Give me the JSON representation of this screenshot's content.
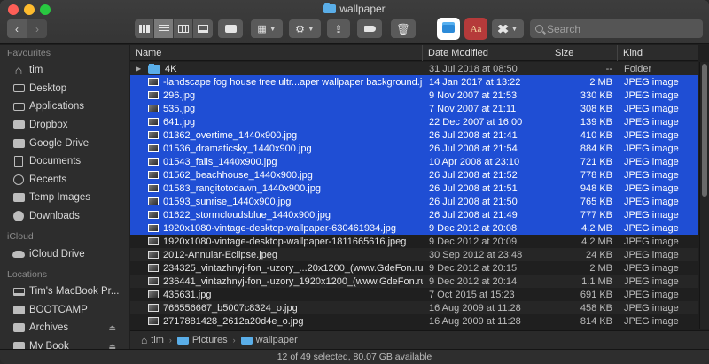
{
  "window": {
    "title": "wallpaper"
  },
  "toolbar": {
    "back_icon": "chevron-left-icon",
    "forward_icon": "chevron-right-icon",
    "search": {
      "placeholder": "Search",
      "value": ""
    },
    "app_dict_label": "Aa"
  },
  "sidebar": {
    "sections": [
      {
        "title": "Favourites",
        "items": [
          {
            "label": "tim",
            "icon": "home-icon"
          },
          {
            "label": "Desktop",
            "icon": "desktop-icon"
          },
          {
            "label": "Applications",
            "icon": "applications-icon"
          },
          {
            "label": "Dropbox",
            "icon": "dropbox-icon"
          },
          {
            "label": "Google Drive",
            "icon": "google-drive-icon"
          },
          {
            "label": "Documents",
            "icon": "documents-icon"
          },
          {
            "label": "Recents",
            "icon": "recents-icon"
          },
          {
            "label": "Temp Images",
            "icon": "folder-icon"
          },
          {
            "label": "Downloads",
            "icon": "downloads-icon"
          }
        ]
      },
      {
        "title": "iCloud",
        "items": [
          {
            "label": "iCloud Drive",
            "icon": "icloud-icon"
          }
        ]
      },
      {
        "title": "Locations",
        "items": [
          {
            "label": "Tim's MacBook Pr...",
            "icon": "laptop-icon"
          },
          {
            "label": "BOOTCAMP",
            "icon": "drive-icon"
          },
          {
            "label": "Archives",
            "icon": "drive-icon",
            "eject": "⏏"
          },
          {
            "label": "My Book",
            "icon": "drive-icon",
            "eject": "⏏"
          }
        ]
      }
    ]
  },
  "table": {
    "columns": {
      "name": "Name",
      "date": "Date Modified",
      "size": "Size",
      "kind": "Kind"
    },
    "rows": [
      {
        "name": "4K",
        "date": "31 Jul 2018 at 08:50",
        "size": "--",
        "kind": "Folder",
        "folder": true,
        "selected": false
      },
      {
        "name": "-landscape fog house tree ultr...aper wallpaper background.jpg",
        "date": "14 Jan 2017 at 13:22",
        "size": "2 MB",
        "kind": "JPEG image",
        "selected": true
      },
      {
        "name": "296.jpg",
        "date": "9 Nov 2007 at 21:53",
        "size": "330 KB",
        "kind": "JPEG image",
        "selected": true
      },
      {
        "name": "535.jpg",
        "date": "7 Nov 2007 at 21:11",
        "size": "308 KB",
        "kind": "JPEG image",
        "selected": true
      },
      {
        "name": "641.jpg",
        "date": "22 Dec 2007 at 16:00",
        "size": "139 KB",
        "kind": "JPEG image",
        "selected": true
      },
      {
        "name": "01362_overtime_1440x900.jpg",
        "date": "26 Jul 2008 at 21:41",
        "size": "410 KB",
        "kind": "JPEG image",
        "selected": true
      },
      {
        "name": "01536_dramaticsky_1440x900.jpg",
        "date": "26 Jul 2008 at 21:54",
        "size": "884 KB",
        "kind": "JPEG image",
        "selected": true
      },
      {
        "name": "01543_falls_1440x900.jpg",
        "date": "10 Apr 2008 at 23:10",
        "size": "721 KB",
        "kind": "JPEG image",
        "selected": true
      },
      {
        "name": "01562_beachhouse_1440x900.jpg",
        "date": "26 Jul 2008 at 21:52",
        "size": "778 KB",
        "kind": "JPEG image",
        "selected": true
      },
      {
        "name": "01583_rangitotodawn_1440x900.jpg",
        "date": "26 Jul 2008 at 21:51",
        "size": "948 KB",
        "kind": "JPEG image",
        "selected": true
      },
      {
        "name": "01593_sunrise_1440x900.jpg",
        "date": "26 Jul 2008 at 21:50",
        "size": "765 KB",
        "kind": "JPEG image",
        "selected": true
      },
      {
        "name": "01622_stormcloudsblue_1440x900.jpg",
        "date": "26 Jul 2008 at 21:49",
        "size": "777 KB",
        "kind": "JPEG image",
        "selected": true
      },
      {
        "name": "1920x1080-vintage-desktop-wallpaper-630461934.jpg",
        "date": "9 Dec 2012 at 20:08",
        "size": "4.2 MB",
        "kind": "JPEG image",
        "selected": true
      },
      {
        "name": "1920x1080-vintage-desktop-wallpaper-1811665616.jpeg",
        "date": "9 Dec 2012 at 20:09",
        "size": "4.2 MB",
        "kind": "JPEG image",
        "selected": false
      },
      {
        "name": "2012-Annular-Eclipse.jpeg",
        "date": "30 Sep 2012 at 23:48",
        "size": "24 KB",
        "kind": "JPEG image",
        "selected": false
      },
      {
        "name": "234325_vintazhnyj-fon_-uzory_...20x1200_(www.GdeFon.ru).jpg",
        "date": "9 Dec 2012 at 20:15",
        "size": "2 MB",
        "kind": "JPEG image",
        "selected": false
      },
      {
        "name": "236441_vintazhnyj-fon_-uzory_1920x1200_(www.GdeFon.ru).jpg",
        "date": "9 Dec 2012 at 20:14",
        "size": "1.1 MB",
        "kind": "JPEG image",
        "selected": false
      },
      {
        "name": "435631.jpg",
        "date": "7 Oct 2015 at 15:23",
        "size": "691 KB",
        "kind": "JPEG image",
        "selected": false
      },
      {
        "name": "766556667_b5007c8324_o.jpg",
        "date": "16 Aug 2009 at 11:28",
        "size": "458 KB",
        "kind": "JPEG image",
        "selected": false
      },
      {
        "name": "2717881428_2612a20d4e_o.jpg",
        "date": "16 Aug 2009 at 11:28",
        "size": "814 KB",
        "kind": "JPEG image",
        "selected": false
      }
    ]
  },
  "pathbar": [
    "tim",
    "Pictures",
    "wallpaper"
  ],
  "status": {
    "text": "12 of 49 selected, 80.07 GB available"
  },
  "colors": {
    "selection": "#1f4ed4",
    "folder": "#5aaee8"
  }
}
